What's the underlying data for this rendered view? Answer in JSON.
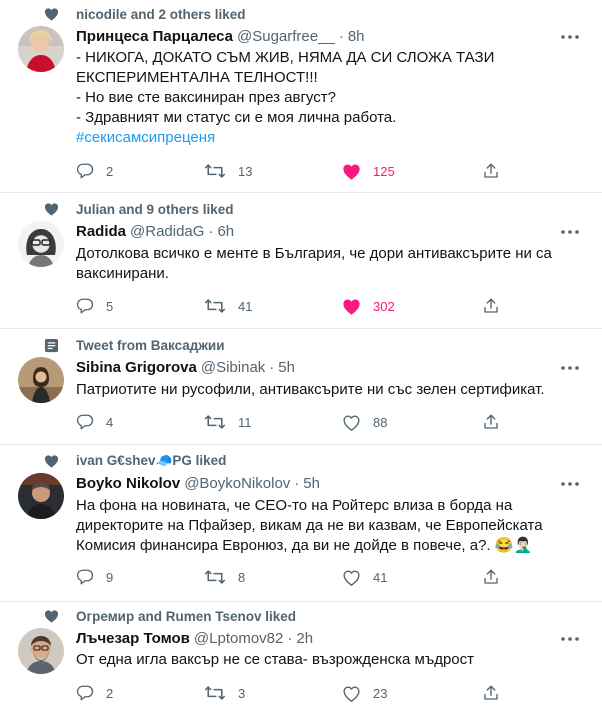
{
  "colors": {
    "like_active": "#f91880",
    "link": "#1d9bf0",
    "muted": "#536471"
  },
  "tweets": [
    {
      "context": "nicodile and 2 others liked",
      "context_icon": "heart-icon",
      "name": "Принцеса Парцалеса",
      "handle": "@Sugarfree__",
      "time": "8h",
      "lines": [
        "- НИКОГА, ДОКАТО СЪМ ЖИВ, НЯМА ДА СИ СЛОЖА ТАЗИ",
        "ЕКСПЕРИМЕНТАЛНА ТЕЛНОСТ!!!",
        "- Но вие сте ваксиниран през август?",
        "- Здравният ми статус си е моя лична работа."
      ],
      "hashtag": "#секисамсипреценя",
      "replies": "2",
      "retweets": "13",
      "likes": "125",
      "liked": true
    },
    {
      "context": "Julian and 9 others liked",
      "context_icon": "heart-icon",
      "name": "Radida",
      "handle": "@RadidaG",
      "time": "6h",
      "lines": [
        "Дотолкова всичко е менте в България, че дори антиваксърите ни са",
        "ваксинирани."
      ],
      "replies": "5",
      "retweets": "41",
      "likes": "302",
      "liked": true
    },
    {
      "context": "Tweet from Ваксаджии",
      "context_icon": "list-icon",
      "name": "Sibina Grigorova",
      "handle": "@Sibinak",
      "time": "5h",
      "lines": [
        "Патриотите ни русофили, антиваксърите ни със зелен сертификат."
      ],
      "replies": "4",
      "retweets": "11",
      "likes": "88",
      "liked": false
    },
    {
      "context": "ivan G€shev🧢PG liked",
      "context_icon": "heart-icon",
      "name": "Boyko Nikolov",
      "handle": "@BoykoNikolov",
      "time": "5h",
      "lines": [
        "На фона на новината, че CEO-то на Ройтерс влиза в борда на",
        "директорите на Пфайзер, викам да не ви казвам, че Европейската",
        "Комисия финансира Евронюз, да ви не дойде в повече, а?. 😂🤦🏻‍♂️"
      ],
      "replies": "9",
      "retweets": "8",
      "likes": "41",
      "liked": false
    },
    {
      "context": "Огремир and Rumen Tsenov liked",
      "context_icon": "heart-icon",
      "name": "Лъчезар Томов",
      "handle": "@Lptomov82",
      "time": "2h",
      "lines": [
        "От една игла ваксър не се става- възрожденска мъдрост"
      ],
      "replies": "2",
      "retweets": "3",
      "likes": "23",
      "liked": false
    }
  ]
}
